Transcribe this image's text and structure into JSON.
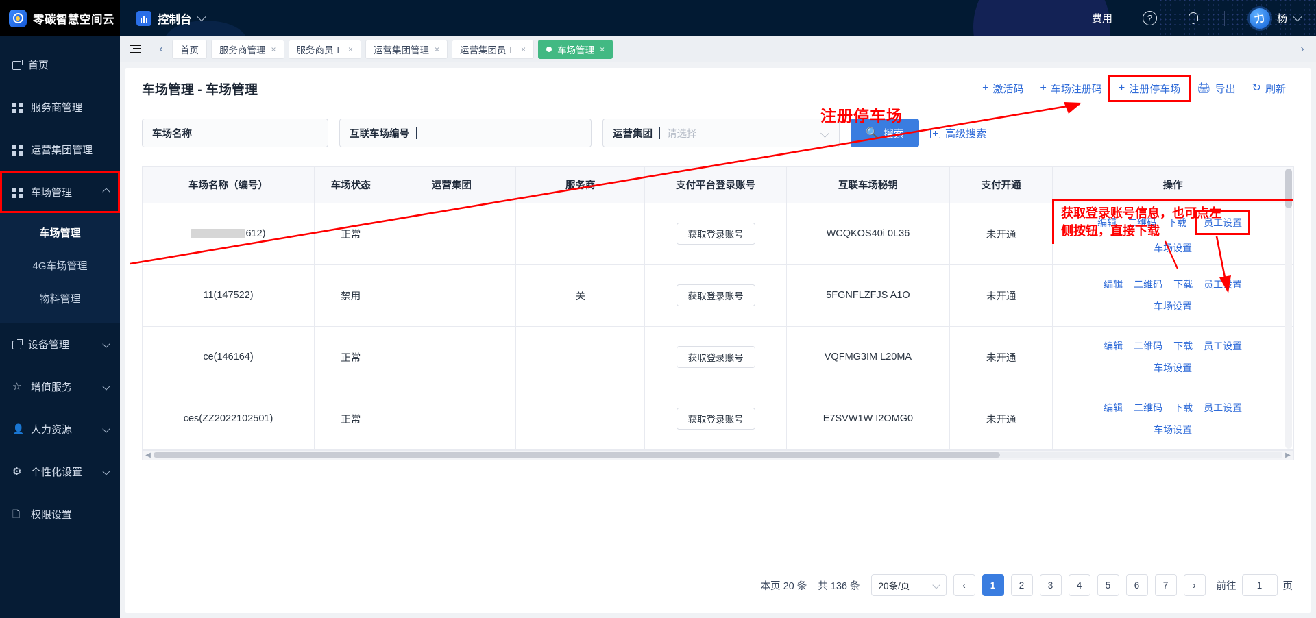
{
  "header": {
    "brand_name": "零碳智慧空间云",
    "console_label": "控制台",
    "fee_label": "费用",
    "help_icon": "?",
    "user_name": "杨",
    "avatar_glyph": "力"
  },
  "sidebar": {
    "items": [
      {
        "label": "首页",
        "icon": "home-icon",
        "arrow": "",
        "highlight": false
      },
      {
        "label": "服务商管理",
        "icon": "grid-icon",
        "arrow": "",
        "highlight": false
      },
      {
        "label": "运营集团管理",
        "icon": "grid-icon",
        "arrow": "",
        "highlight": false
      },
      {
        "label": "车场管理",
        "icon": "grid-icon",
        "arrow": "up",
        "highlight": true
      },
      {
        "label": "设备管理",
        "icon": "home-icon",
        "arrow": "down",
        "highlight": false
      },
      {
        "label": "增值服务",
        "icon": "star-icon",
        "arrow": "down",
        "highlight": false
      },
      {
        "label": "人力资源",
        "icon": "user-icon",
        "arrow": "down",
        "highlight": false
      },
      {
        "label": "个性化设置",
        "icon": "gear-icon",
        "arrow": "down",
        "highlight": false
      },
      {
        "label": "权限设置",
        "icon": "doc-icon",
        "arrow": "",
        "highlight": false
      }
    ],
    "sub_items": [
      {
        "label": "车场管理",
        "active": true,
        "boxed": true
      },
      {
        "label": "4G车场管理",
        "active": false,
        "boxed": false
      },
      {
        "label": "物料管理",
        "active": false,
        "boxed": false
      }
    ]
  },
  "tabs": {
    "collapse_icon": "menu-collapse-icon",
    "prev_icon": "‹",
    "next_icon": "›",
    "items": [
      {
        "label": "首页",
        "closable": false,
        "active": false
      },
      {
        "label": "服务商管理",
        "closable": true,
        "active": false
      },
      {
        "label": "服务商员工",
        "closable": true,
        "active": false
      },
      {
        "label": "运营集团管理",
        "closable": true,
        "active": false
      },
      {
        "label": "运营集团员工",
        "closable": true,
        "active": false
      },
      {
        "label": "车场管理",
        "closable": true,
        "active": true
      }
    ],
    "close_glyph": "×"
  },
  "page": {
    "title": "车场管理 - 车场管理",
    "actions": [
      {
        "label": "激活码",
        "icon": "plus-icon",
        "boxed": false
      },
      {
        "label": "车场注册码",
        "icon": "plus-icon",
        "boxed": false
      },
      {
        "label": "注册停车场",
        "icon": "plus-icon",
        "boxed": true
      },
      {
        "label": "导出",
        "icon": "export-icon",
        "boxed": false
      },
      {
        "label": "刷新",
        "icon": "refresh-icon",
        "boxed": false
      }
    ]
  },
  "search": {
    "field1_label": "车场名称",
    "field1_value": "",
    "field2_label": "互联车场编号",
    "field2_value": "",
    "field3_label": "运营集团",
    "field3_placeholder": "请选择",
    "search_button": "搜索",
    "search_icon": "search-icon",
    "advanced_label": "高级搜索"
  },
  "table": {
    "columns": [
      "车场名称（编号）",
      "车场状态",
      "运营集团",
      "服务商",
      "支付平台登录账号",
      "互联车场秘钥",
      "支付开通",
      "操作"
    ],
    "rows": [
      {
        "name": "612)",
        "name_masked": true,
        "status": "正常",
        "group": "",
        "provider": "",
        "account_button": "获取登录账号",
        "secret": "WCQKOS40i 0L36",
        "pay": "未开通",
        "ops": [
          "编辑",
          "二维码",
          "下载",
          "员工设置"
        ],
        "ops_row2": "车场设置",
        "ops_boxed": true
      },
      {
        "name": "11(147522)",
        "name_masked": false,
        "status": "禁用",
        "group": "",
        "provider": "关",
        "account_button": "获取登录账号",
        "secret": "5FGNFLZFJS A1O",
        "pay": "未开通",
        "ops": [
          "编辑",
          "二维码",
          "下载",
          "员工设置"
        ],
        "ops_row2": "车场设置",
        "ops_boxed": false
      },
      {
        "name": "ce(146164)",
        "name_masked": false,
        "status": "正常",
        "group": "",
        "provider": "",
        "account_button": "获取登录账号",
        "secret": "VQFMG3IM L20MA",
        "pay": "未开通",
        "ops": [
          "编辑",
          "二维码",
          "下载",
          "员工设置"
        ],
        "ops_row2": "车场设置",
        "ops_boxed": false
      },
      {
        "name": "ces(ZZ2022102501)",
        "name_masked": false,
        "status": "正常",
        "group": "",
        "provider": "",
        "account_button": "获取登录账号",
        "secret": "E7SVW1W I2OMG0",
        "pay": "未开通",
        "ops": [
          "编辑",
          "二维码",
          "下载",
          "员工设置"
        ],
        "ops_row2": "车场设置",
        "ops_boxed": false
      }
    ]
  },
  "pagination": {
    "page_count_label": "本页 20 条",
    "total_label": "共 136 条",
    "page_size": "20条/页",
    "prev": "‹",
    "next": "›",
    "pages": [
      "1",
      "2",
      "3",
      "4",
      "5",
      "6",
      "7"
    ],
    "current_page": "1",
    "jump_label": "前往",
    "jump_value": "1",
    "jump_suffix": "页"
  },
  "annotations": {
    "title": "注册停车场",
    "note_line1": "获取登录账号信息，也可点左",
    "note_line2": "侧按钮，直接下载"
  },
  "colors": {
    "accent": "#3a7de0",
    "link": "#2f6bd8",
    "annotation": "#ff0000",
    "active_tab": "#42b983",
    "header_bg": "#021a33",
    "sidebar_bg": "#061c35"
  }
}
